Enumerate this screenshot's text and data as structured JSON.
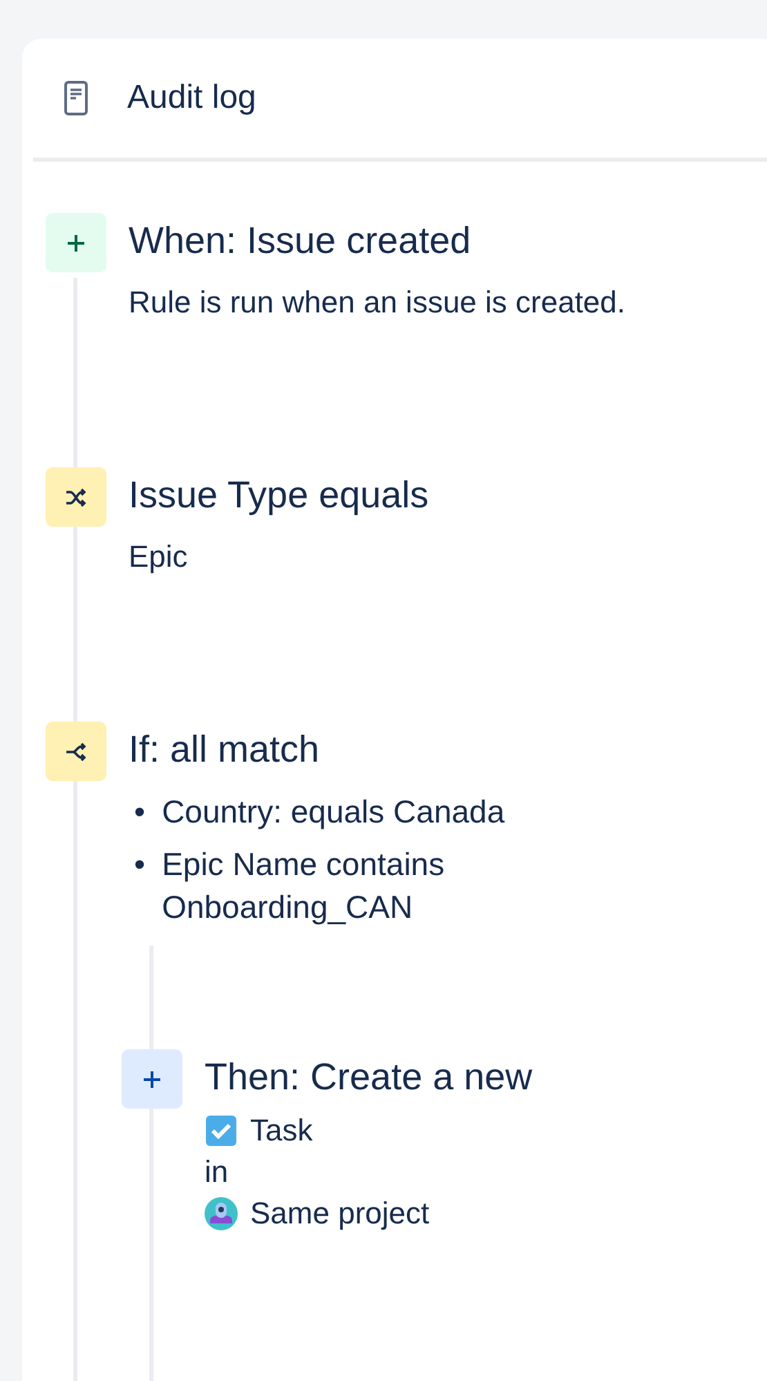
{
  "header": {
    "title": "Audit log"
  },
  "steps": [
    {
      "kind": "trigger",
      "title": "When: Issue created",
      "description": "Rule is run when an issue is created."
    },
    {
      "kind": "condition",
      "title": "Issue Type equals",
      "description": "Epic"
    },
    {
      "kind": "if",
      "title": "If: all match",
      "bullets": [
        {
          "marker": "•",
          "text": "Country: equals Canada"
        },
        {
          "marker": "•",
          "text": "Epic Name contains Onboarding_CAN"
        }
      ],
      "children": [
        {
          "kind": "action",
          "title": "Then: Create a new",
          "lines": [
            {
              "kind": "issue-type",
              "text": "Task"
            },
            {
              "kind": "plain",
              "text": "in"
            },
            {
              "kind": "project",
              "text": "Same project"
            }
          ]
        }
      ]
    }
  ]
}
